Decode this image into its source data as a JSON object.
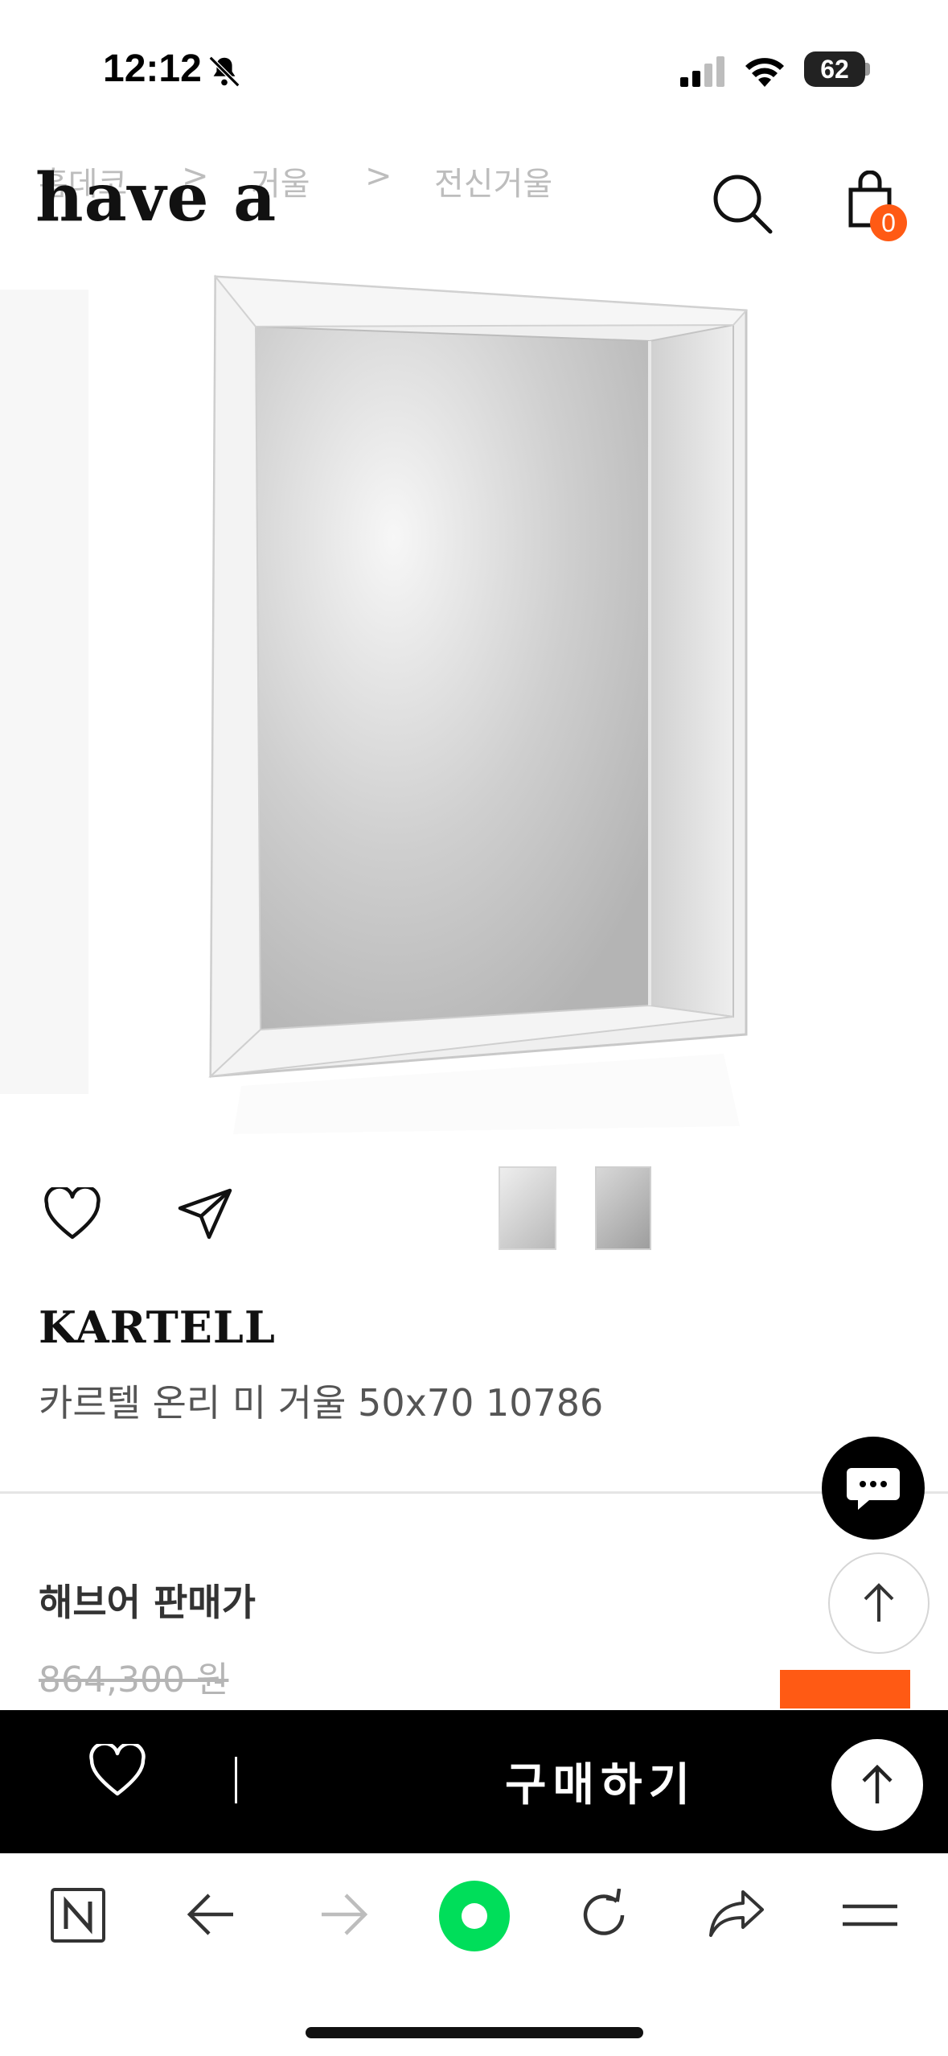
{
  "status_bar": {
    "time": "12:12",
    "battery": "62"
  },
  "breadcrumb": {
    "items": [
      "홈데코",
      "거울",
      "전신거울"
    ],
    "separator": ">"
  },
  "header": {
    "logo": "have a",
    "cart_count": "0"
  },
  "product": {
    "brand": "KARTELL",
    "name": "카르텔 온리 미 거울 50x70 10786",
    "price_label": "해브어 판매가",
    "original_price": "864,300 원"
  },
  "buy_bar": {
    "buy_label": "구매하기"
  },
  "icons": {
    "wishlist": "heart-icon",
    "share": "send-icon",
    "search": "search-icon",
    "cart": "shopping-bag-icon",
    "chat": "chat-icon",
    "scroll_top": "arrow-up-icon",
    "browser_home": "naver-icon",
    "back": "arrow-left-icon",
    "forward": "arrow-right-icon",
    "green_dot": "green-dot-icon",
    "reload": "reload-icon",
    "browser_share": "share-arrow-icon",
    "menu": "menu-icon"
  },
  "colors": {
    "accent": "#ff5a14",
    "buy_bar": "#000000",
    "green": "#00de5a"
  }
}
